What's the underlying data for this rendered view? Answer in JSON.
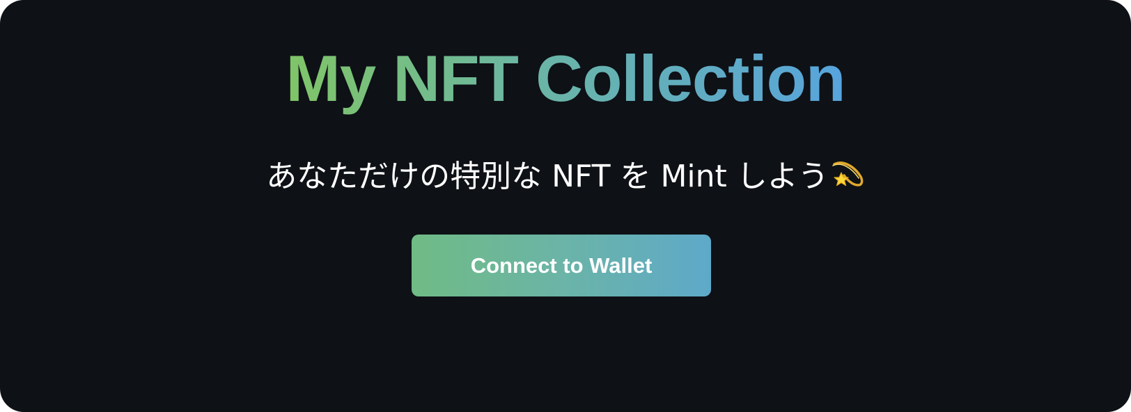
{
  "header": {
    "title": "My NFT Collection",
    "subtitle": "あなただけの特別な NFT を Mint しよう",
    "subtitle_icon": "dizzy-sparkle-icon"
  },
  "actions": {
    "connect_label": "Connect to Wallet"
  },
  "colors": {
    "background": "#0e1116",
    "title_gradient_start": "#80c567",
    "title_gradient_end": "#57a4dd",
    "button_gradient_start": "#70bb85",
    "button_gradient_end": "#5ea9c9",
    "text": "#ffffff"
  }
}
